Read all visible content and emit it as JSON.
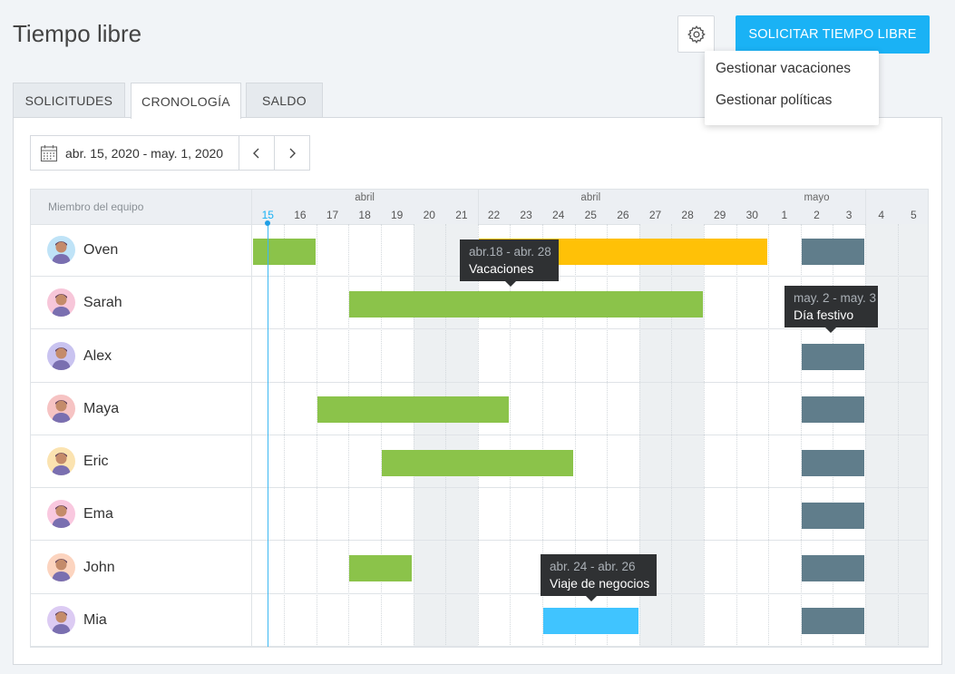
{
  "page": {
    "title": "Tiempo libre"
  },
  "header": {
    "request_button": "SOLICITAR TIEMPO LIBRE",
    "settings_icon": "gear-icon"
  },
  "settings_menu": {
    "items": [
      "Gestionar vacaciones",
      "Gestionar políticas"
    ]
  },
  "tabs": [
    {
      "label": "SOLICITUDES",
      "active": false
    },
    {
      "label": "CRONOLOGÍA",
      "active": true
    },
    {
      "label": "SALDO",
      "active": false
    }
  ],
  "date_range": {
    "label": "abr. 15, 2020 - may. 1, 2020",
    "prev_icon": "chevron-left-icon",
    "next_icon": "chevron-right-icon",
    "calendar_icon": "calendar-icon"
  },
  "timeline": {
    "member_column_label": "Miembro del equipo",
    "month_labels": [
      "abril",
      "abril",
      "mayo"
    ],
    "days": [
      15,
      16,
      17,
      18,
      19,
      20,
      21,
      22,
      23,
      24,
      25,
      26,
      27,
      28,
      29,
      30,
      1,
      2,
      3,
      4,
      5
    ],
    "today": 15,
    "colors": {
      "vacation_green": "#8bc34a",
      "vacation_yellow": "#ffc107",
      "holiday": "#607d8b",
      "business_trip": "#40c4ff",
      "accent": "#1ab2f5"
    },
    "members": [
      {
        "name": "Oven",
        "avatar_color": "#bfe3f7"
      },
      {
        "name": "Sarah",
        "avatar_color": "#f7c6d9"
      },
      {
        "name": "Alex",
        "avatar_color": "#c9c3f0"
      },
      {
        "name": "Maya",
        "avatar_color": "#f6c3c3"
      },
      {
        "name": "Eric",
        "avatar_color": "#fbe3b0"
      },
      {
        "name": "Ema",
        "avatar_color": "#f9c8df"
      },
      {
        "name": "John",
        "avatar_color": "#fcd4bf"
      },
      {
        "name": "Mia",
        "avatar_color": "#dccbf3"
      }
    ],
    "bars": [
      {
        "member": 0,
        "start": 0,
        "end": 1,
        "type": "vacation_green"
      },
      {
        "member": 0,
        "start": 7,
        "end": 15,
        "type": "vacation_yellow"
      },
      {
        "member": 1,
        "start": 3,
        "end": 13,
        "type": "vacation_green"
      },
      {
        "member": 3,
        "start": 2,
        "end": 7,
        "type": "vacation_green"
      },
      {
        "member": 4,
        "start": 4,
        "end": 9,
        "type": "vacation_green"
      },
      {
        "member": 6,
        "start": 3,
        "end": 4,
        "type": "vacation_green"
      },
      {
        "member": 7,
        "start": 9,
        "end": 11,
        "type": "business_trip"
      }
    ],
    "holidays": {
      "start": 17,
      "end": 18,
      "type": "holiday"
    },
    "tooltips": [
      {
        "dates": "abr.18 - abr. 28",
        "type": "Vacaciones"
      },
      {
        "dates": "may. 2 - may. 3",
        "type": "Día festivo"
      },
      {
        "dates": "abr. 24 - abr. 26",
        "type": "Viaje de negocios"
      }
    ]
  }
}
